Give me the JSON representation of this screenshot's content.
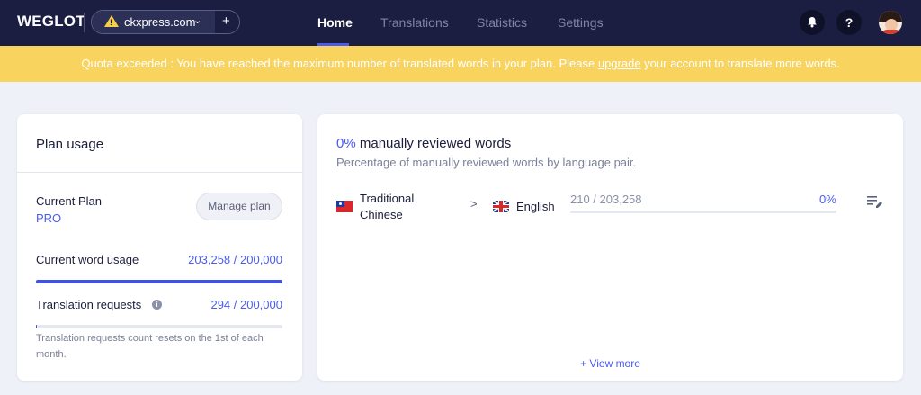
{
  "app": {
    "logo": "WEGLOT"
  },
  "project": {
    "name": "ckxpress.com",
    "add": "+",
    "chevron": "⌄"
  },
  "nav": {
    "tabs": [
      {
        "label": "Home",
        "active": true
      },
      {
        "label": "Translations",
        "active": false
      },
      {
        "label": "Statistics",
        "active": false
      },
      {
        "label": "Settings",
        "active": false
      }
    ],
    "notifications_icon": "bell-icon",
    "help": "?"
  },
  "banner": {
    "text_before": "Quota exceeded : You have reached the maximum number of translated words in your plan. Please ",
    "link": "upgrade",
    "text_after": " your account to translate more words.",
    "bg_color": "#f8d35e"
  },
  "plan_usage": {
    "title": "Plan usage",
    "current_plan_label": "Current Plan",
    "current_plan_value": "PRO",
    "manage_button": "Manage plan",
    "word_usage_label": "Current word usage",
    "word_usage_value": "203,258 / 200,000",
    "word_usage_fraction": 1.0,
    "requests_label": "Translation requests",
    "requests_value": "294 / 200,000",
    "requests_fraction": 0.0015,
    "info_icon": "i",
    "reset_note": "Translation requests count resets on the 1st of each month."
  },
  "review": {
    "title_pct": "0%",
    "title_text": " manually reviewed words",
    "subtitle": "Percentage of manually reviewed words by language pair.",
    "pairs": [
      {
        "source": "Traditional Chinese",
        "target": "English",
        "count": "210 / 203,258",
        "percent": "0%",
        "fraction": 0.0
      }
    ],
    "arrow": ">",
    "view_more": "+ View more"
  },
  "colors": {
    "accent": "#4a5bf0",
    "nav_bg": "#1b1e41",
    "warning": "#f5cf47"
  }
}
